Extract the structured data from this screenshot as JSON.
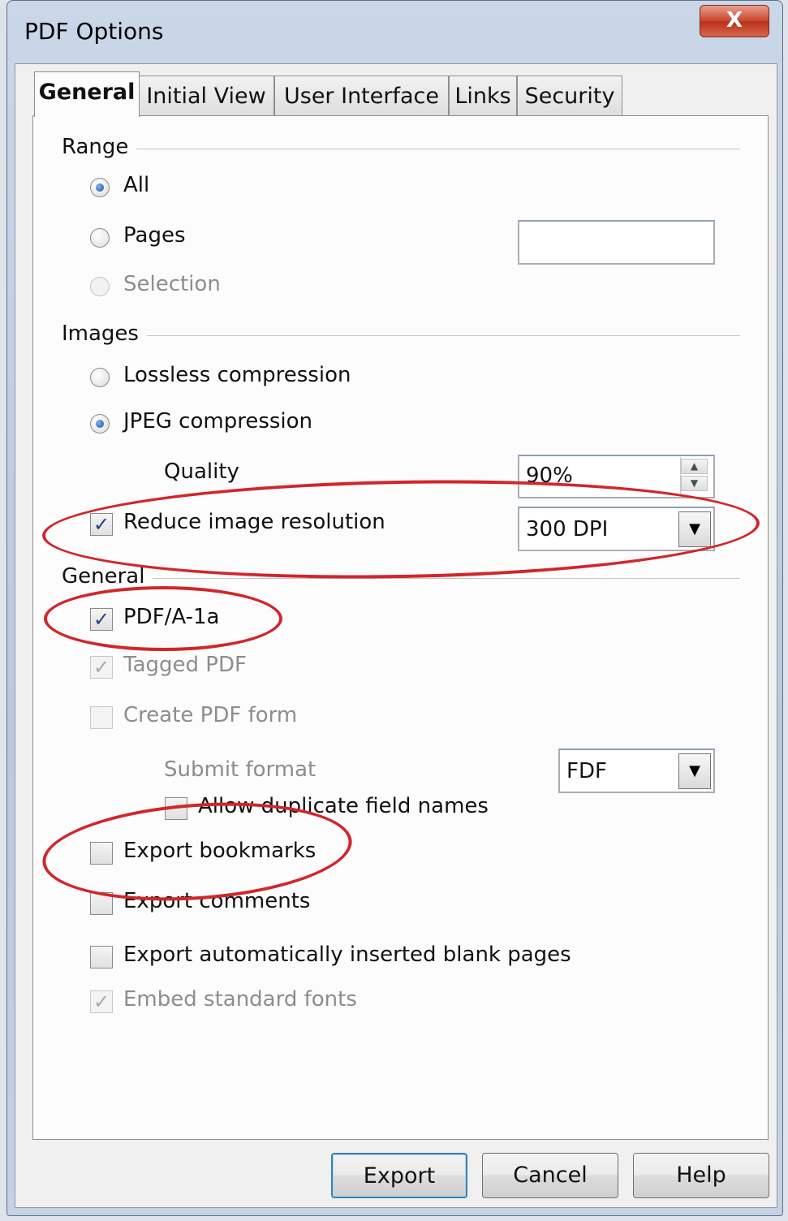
{
  "window": {
    "title": "PDF Options",
    "close_glyph": "X"
  },
  "tabs": [
    {
      "label": "General",
      "active": true
    },
    {
      "label": "Initial View",
      "active": false
    },
    {
      "label": "User Interface",
      "active": false
    },
    {
      "label": "Links",
      "active": false
    },
    {
      "label": "Security",
      "active": false
    }
  ],
  "range": {
    "heading": "Range",
    "all_label": "All",
    "pages_label": "Pages",
    "pages_value": "",
    "selection_label": "Selection",
    "selected": "All"
  },
  "images": {
    "heading": "Images",
    "lossless_label": "Lossless compression",
    "jpeg_label": "JPEG compression",
    "selected": "JPEG compression",
    "quality_label": "Quality",
    "quality_value": "90%",
    "reduce_label": "Reduce image resolution",
    "reduce_checked": true,
    "resolution_value": "300 DPI"
  },
  "general": {
    "heading": "General",
    "pdfa_label": "PDF/A-1a",
    "pdfa_checked": true,
    "tagged_label": "Tagged PDF",
    "tagged_checked": true,
    "form_label": "Create PDF form",
    "form_checked": false,
    "submit_format_label": "Submit format",
    "submit_format_value": "FDF",
    "duplicate_label": "Allow duplicate field names",
    "bookmarks_label": "Export bookmarks",
    "comments_label": "Export comments",
    "blank_pages_label": "Export automatically inserted blank pages",
    "embed_fonts_label": "Embed standard fonts",
    "embed_fonts_checked": true
  },
  "icons": {
    "check": "✓",
    "spin_up": "▲",
    "spin_down": "▼",
    "dropdown": "▼"
  },
  "buttons": {
    "export": "Export",
    "cancel": "Cancel",
    "help": "Help"
  },
  "colors": {
    "annotation": "#d1262b",
    "radio_dot": "#1d4f9a"
  }
}
